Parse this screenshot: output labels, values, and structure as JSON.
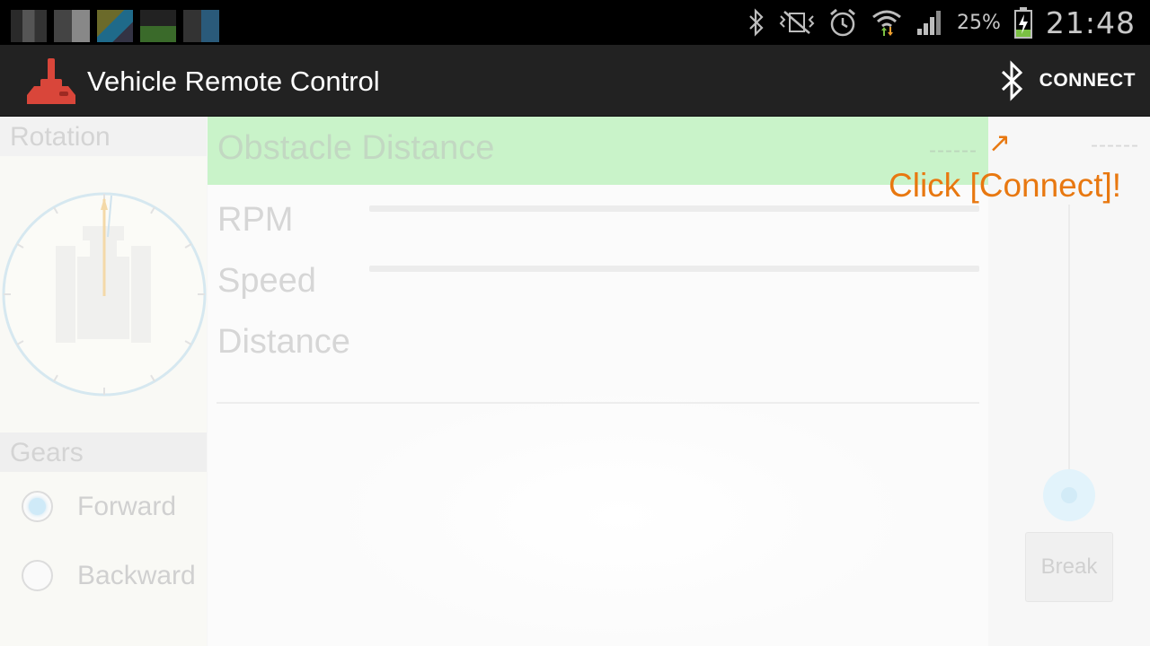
{
  "status_bar": {
    "battery_percent": "25%",
    "time": "21:48",
    "icons": [
      "bluetooth-icon",
      "vibrate-mute-icon",
      "alarm-icon",
      "wifi-icon",
      "signal-icon",
      "battery-charging-icon"
    ]
  },
  "action_bar": {
    "title": "Vehicle Remote Control",
    "connect_label": "CONNECT",
    "icons": [
      "joystick-icon",
      "bluetooth-icon"
    ]
  },
  "left_panel": {
    "rotation_header": "Rotation",
    "gears_header": "Gears",
    "gears": [
      {
        "label": "Forward",
        "checked": true
      },
      {
        "label": "Backward",
        "checked": false
      }
    ]
  },
  "center_panel": {
    "obstacle_label": "Obstacle Distance",
    "obstacle_value": "------",
    "rpm_label": "RPM",
    "speed_label": "Speed",
    "distance_label": "Distance",
    "rpm_level": 0,
    "speed_level": 0
  },
  "right_panel": {
    "value": "------",
    "break_label": "Break"
  },
  "hint": {
    "arrow": "↗",
    "text": "Click [Connect]!"
  },
  "colors": {
    "action_bar": "#222222",
    "obstacle_bar": "#c9f3c9",
    "hint": "#e87810",
    "app_icon": "#d9463a"
  }
}
